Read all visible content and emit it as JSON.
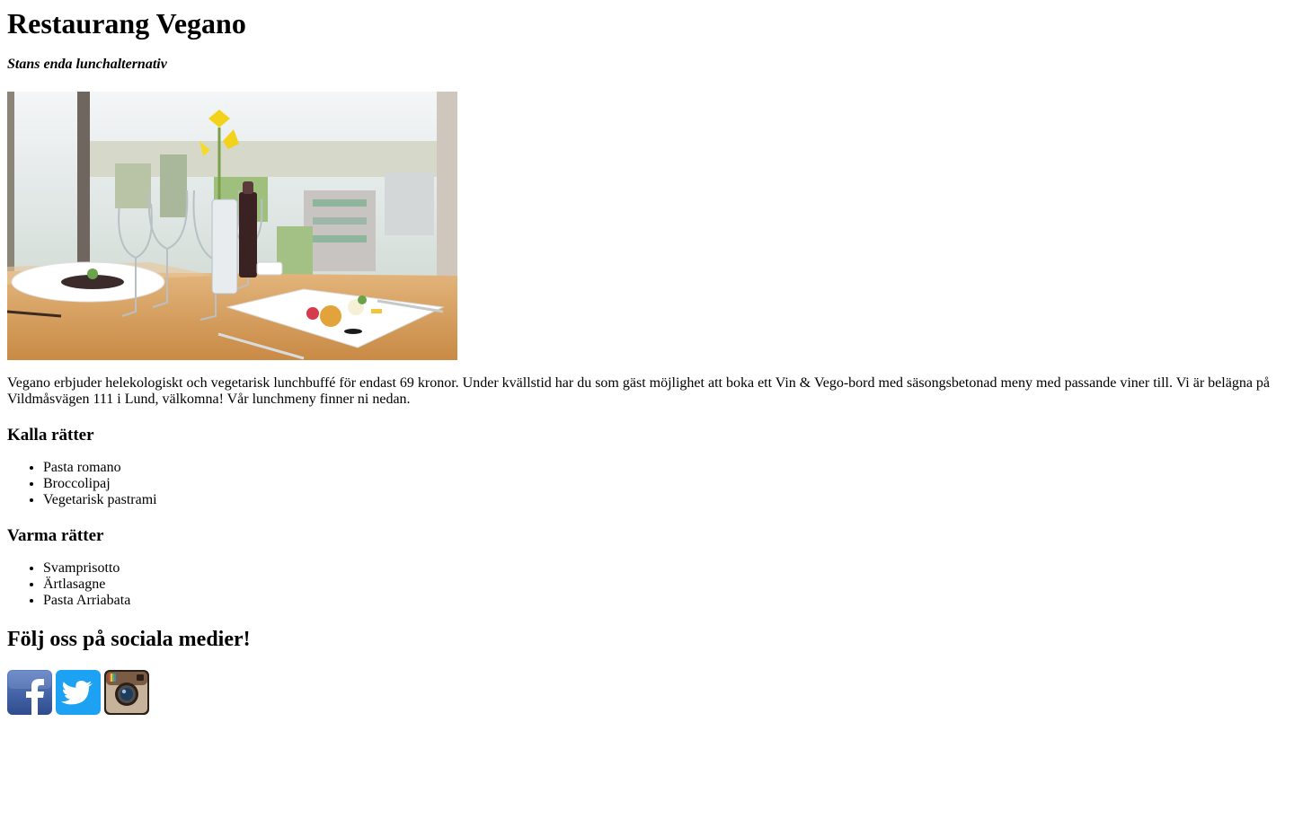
{
  "header": {
    "title": "Restaurang Vegano",
    "tagline": "Stans enda lunchalternativ"
  },
  "hero_image": {
    "icon": "restaurant-table-photo"
  },
  "intro": "Vegano erbjuder helekologiskt och vegetarisk lunchbuffé för endast 69 kronor. Under kvällstid har du som gäst möjlighet att boka ett Vin & Vego-bord med säsongsbetonad meny med passande viner till. Vi är belägna på Vildmåsvägen 111 i Lund, välkomna! Vår lunchmeny finner ni nedan.",
  "menu": {
    "cold": {
      "heading": "Kalla rätter",
      "items": [
        "Pasta romano",
        "Broccolipaj",
        "Vegetarisk pastrami"
      ]
    },
    "warm": {
      "heading": "Varma rätter",
      "items": [
        "Svamprisotto",
        "Ärtlasagne",
        "Pasta Arriabata"
      ]
    }
  },
  "social": {
    "heading": "Följ oss på sociala medier!",
    "links": [
      {
        "icon": "facebook-icon",
        "color": "#3b5998"
      },
      {
        "icon": "twitter-icon",
        "color": "#1da1f2"
      },
      {
        "icon": "instagram-icon",
        "color": "#8a6a4f"
      }
    ]
  }
}
